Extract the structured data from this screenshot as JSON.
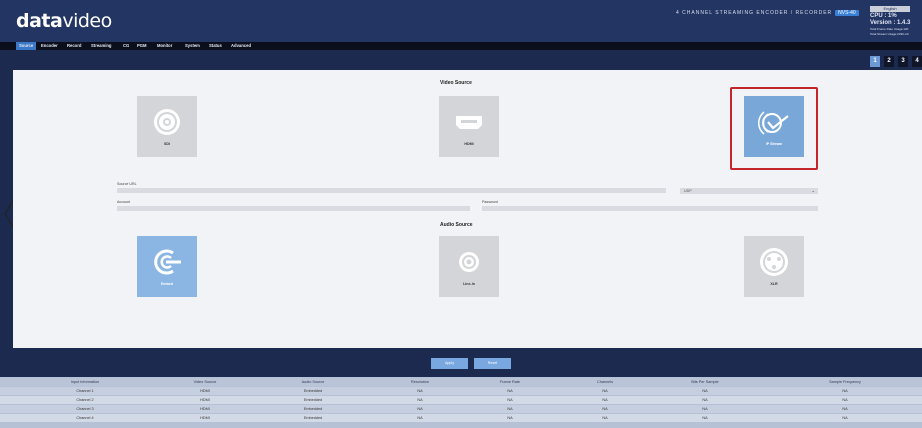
{
  "header": {
    "logo_bold": "data",
    "logo_light": "video",
    "device_title": "4 CHANNEL STREAMING ENCODER / RECORDER",
    "device_tag": "NVS-40",
    "language": "English",
    "cpu": "CPU : 1%",
    "version": "Version : 1.4.3",
    "stat1": "Total Frame Rate Usage:120",
    "stat2": "Total Stream Usage:2330 mb"
  },
  "nav": {
    "tabs": [
      "Source",
      "Encoder",
      "Record",
      "Streaming",
      "CG",
      "PGM",
      "Monitor",
      "System",
      "Status",
      "Advanced"
    ],
    "active": "Source"
  },
  "channels": [
    "1",
    "2",
    "3",
    "4"
  ],
  "video_source": {
    "title": "Video Source",
    "tiles": [
      "SDI",
      "HDMI",
      "IP Stream"
    ],
    "selected": "IP Stream"
  },
  "stream_form": {
    "source_url_label": "Source URL",
    "source_url_value": "",
    "protocol_value": "UDP",
    "account_label": "Account",
    "account_value": "",
    "password_label": "Password",
    "password_value": ""
  },
  "audio_source": {
    "title": "Audio Source",
    "tiles": [
      "Embed",
      "Line-In",
      "XLR"
    ],
    "selected": "Embed"
  },
  "buttons": {
    "apply": "Apply",
    "reset": "Reset"
  },
  "table": {
    "headers": [
      "Input Information",
      "Video Source",
      "Audio Source",
      "Resolution",
      "Frame Rate",
      "Channels",
      "Bits Per Sample",
      "Sample Frequency"
    ],
    "rows": [
      [
        "Channel 1",
        "HDMI",
        "Embedded",
        "NA",
        "NA",
        "NA",
        "NA",
        "NA"
      ],
      [
        "Channel 2",
        "HDMI",
        "Embedded",
        "NA",
        "NA",
        "NA",
        "NA",
        "NA"
      ],
      [
        "Channel 3",
        "HDMI",
        "Embedded",
        "NA",
        "NA",
        "NA",
        "NA",
        "NA"
      ],
      [
        "Channel 4",
        "HDMI",
        "Embedded",
        "NA",
        "NA",
        "NA",
        "NA",
        "NA"
      ]
    ]
  },
  "colors": {
    "header_bg": "#223563",
    "accent": "#3a78c8",
    "selected_tile": "#79a8d8",
    "highlight": "#c4252b"
  }
}
